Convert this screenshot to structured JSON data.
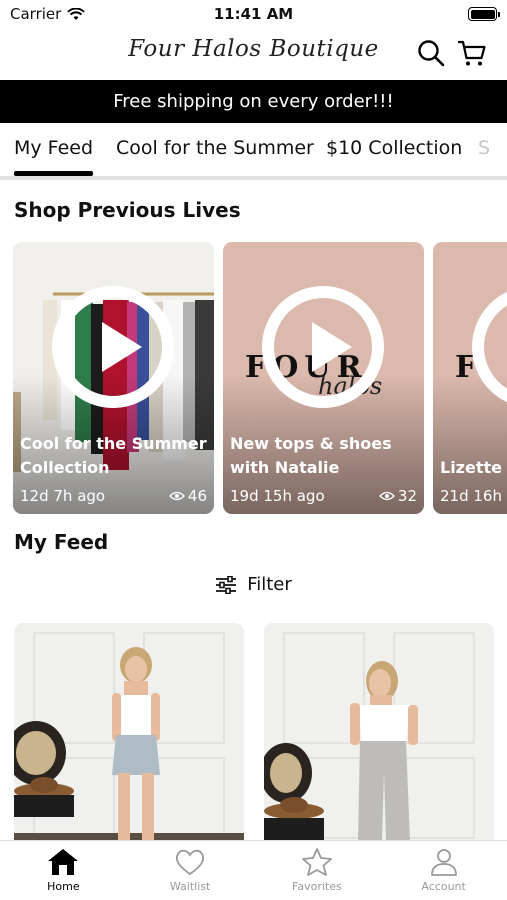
{
  "status": {
    "carrier": "Carrier",
    "time": "11:41 AM"
  },
  "header": {
    "logo": "Four Halos Boutique"
  },
  "promo": "Free shipping on every order!!!",
  "tabs": [
    "My Feed",
    "Cool for the Summer",
    "$10 Collection",
    "S"
  ],
  "sections": {
    "previous_lives": "Shop Previous Lives",
    "my_feed": "My Feed"
  },
  "lives": [
    {
      "title": "Cool for the Summer Collection",
      "age": "12d 7h ago",
      "views": "46"
    },
    {
      "title": "New tops & shoes with Natalie",
      "age": "19d 15h ago",
      "views": "32"
    },
    {
      "title": "Lizette & are live!",
      "age": "21d 16h"
    }
  ],
  "live_brand": {
    "wordmark": "FOUR",
    "script": "halos",
    "wordmark_partial": "F"
  },
  "filter_label": "Filter",
  "bottom_nav": [
    "Home",
    "Waitlist",
    "Favorites",
    "Account"
  ],
  "colors": {
    "promo_bg": "#000000",
    "card_pink": "#dcb9ad",
    "tab_active": "#000000",
    "nav_inactive": "#999999"
  }
}
